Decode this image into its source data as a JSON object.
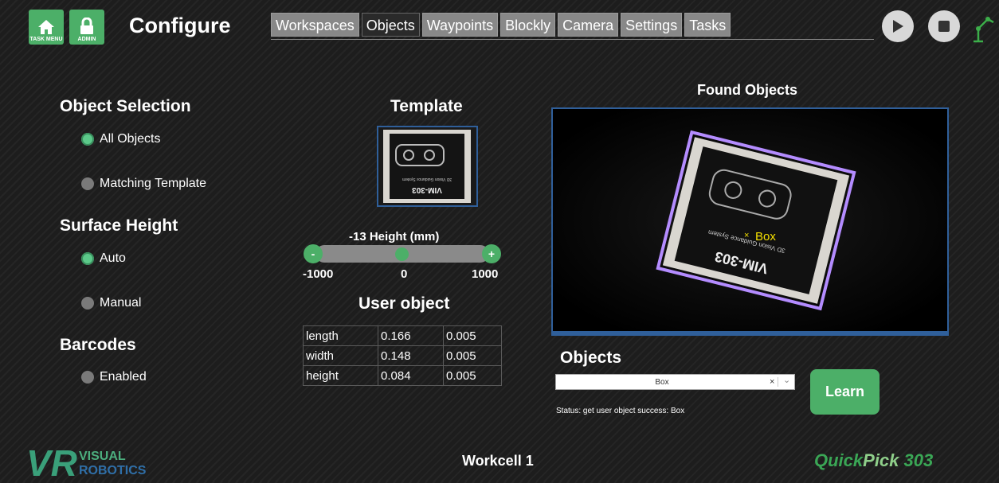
{
  "header": {
    "task_menu_label": "TASK MENU",
    "admin_label": "ADMIN",
    "title": "Configure",
    "tabs": [
      "Workspaces",
      "Objects",
      "Waypoints",
      "Blockly",
      "Camera",
      "Settings",
      "Tasks"
    ],
    "active_tab": "Objects"
  },
  "object_selection": {
    "heading": "Object Selection",
    "options": [
      "All Objects",
      "Matching Template"
    ],
    "selected": "All Objects"
  },
  "surface_height": {
    "heading": "Surface Height",
    "options": [
      "Auto",
      "Manual"
    ],
    "selected": "Auto"
  },
  "barcodes": {
    "heading": "Barcodes",
    "option": "Enabled",
    "enabled": false
  },
  "template": {
    "heading": "Template",
    "box_text": "VIM-303",
    "box_subtext": "3D Vision Guidance System"
  },
  "height_slider": {
    "label": "-13 Height (mm)",
    "value": -13,
    "min_label": "-1000",
    "mid_label": "0",
    "max_label": "1000",
    "minus": "-",
    "plus": "+"
  },
  "user_object": {
    "heading": "User object",
    "rows": [
      [
        "length",
        "0.166",
        "0.005"
      ],
      [
        "width",
        "0.148",
        "0.005"
      ],
      [
        "height",
        "0.084",
        "0.005"
      ]
    ]
  },
  "found_objects": {
    "heading": "Found Objects",
    "detected_label": "Box",
    "box_text": "VIM-303",
    "box_subtext": "3D Vision Guidance System"
  },
  "objects": {
    "heading": "Objects",
    "selected": "Box",
    "clear": "×",
    "chevron": "⌄",
    "learn_label": "Learn",
    "status": "Status: get user object success: Box"
  },
  "footer": {
    "logo_main": "VR",
    "logo_line1": "VISUAL",
    "logo_line2": "ROBOTICS",
    "workcell": "Workcell 1",
    "product_quick": "Quick",
    "product_pick": "Pick",
    "product_num": "303"
  },
  "colors": {
    "accent_green": "#4caf68",
    "radio_on": "#5cc98a",
    "frame_blue": "#2f5f9a",
    "detection_outline": "#b48cff",
    "product_green": "#3aa655"
  }
}
